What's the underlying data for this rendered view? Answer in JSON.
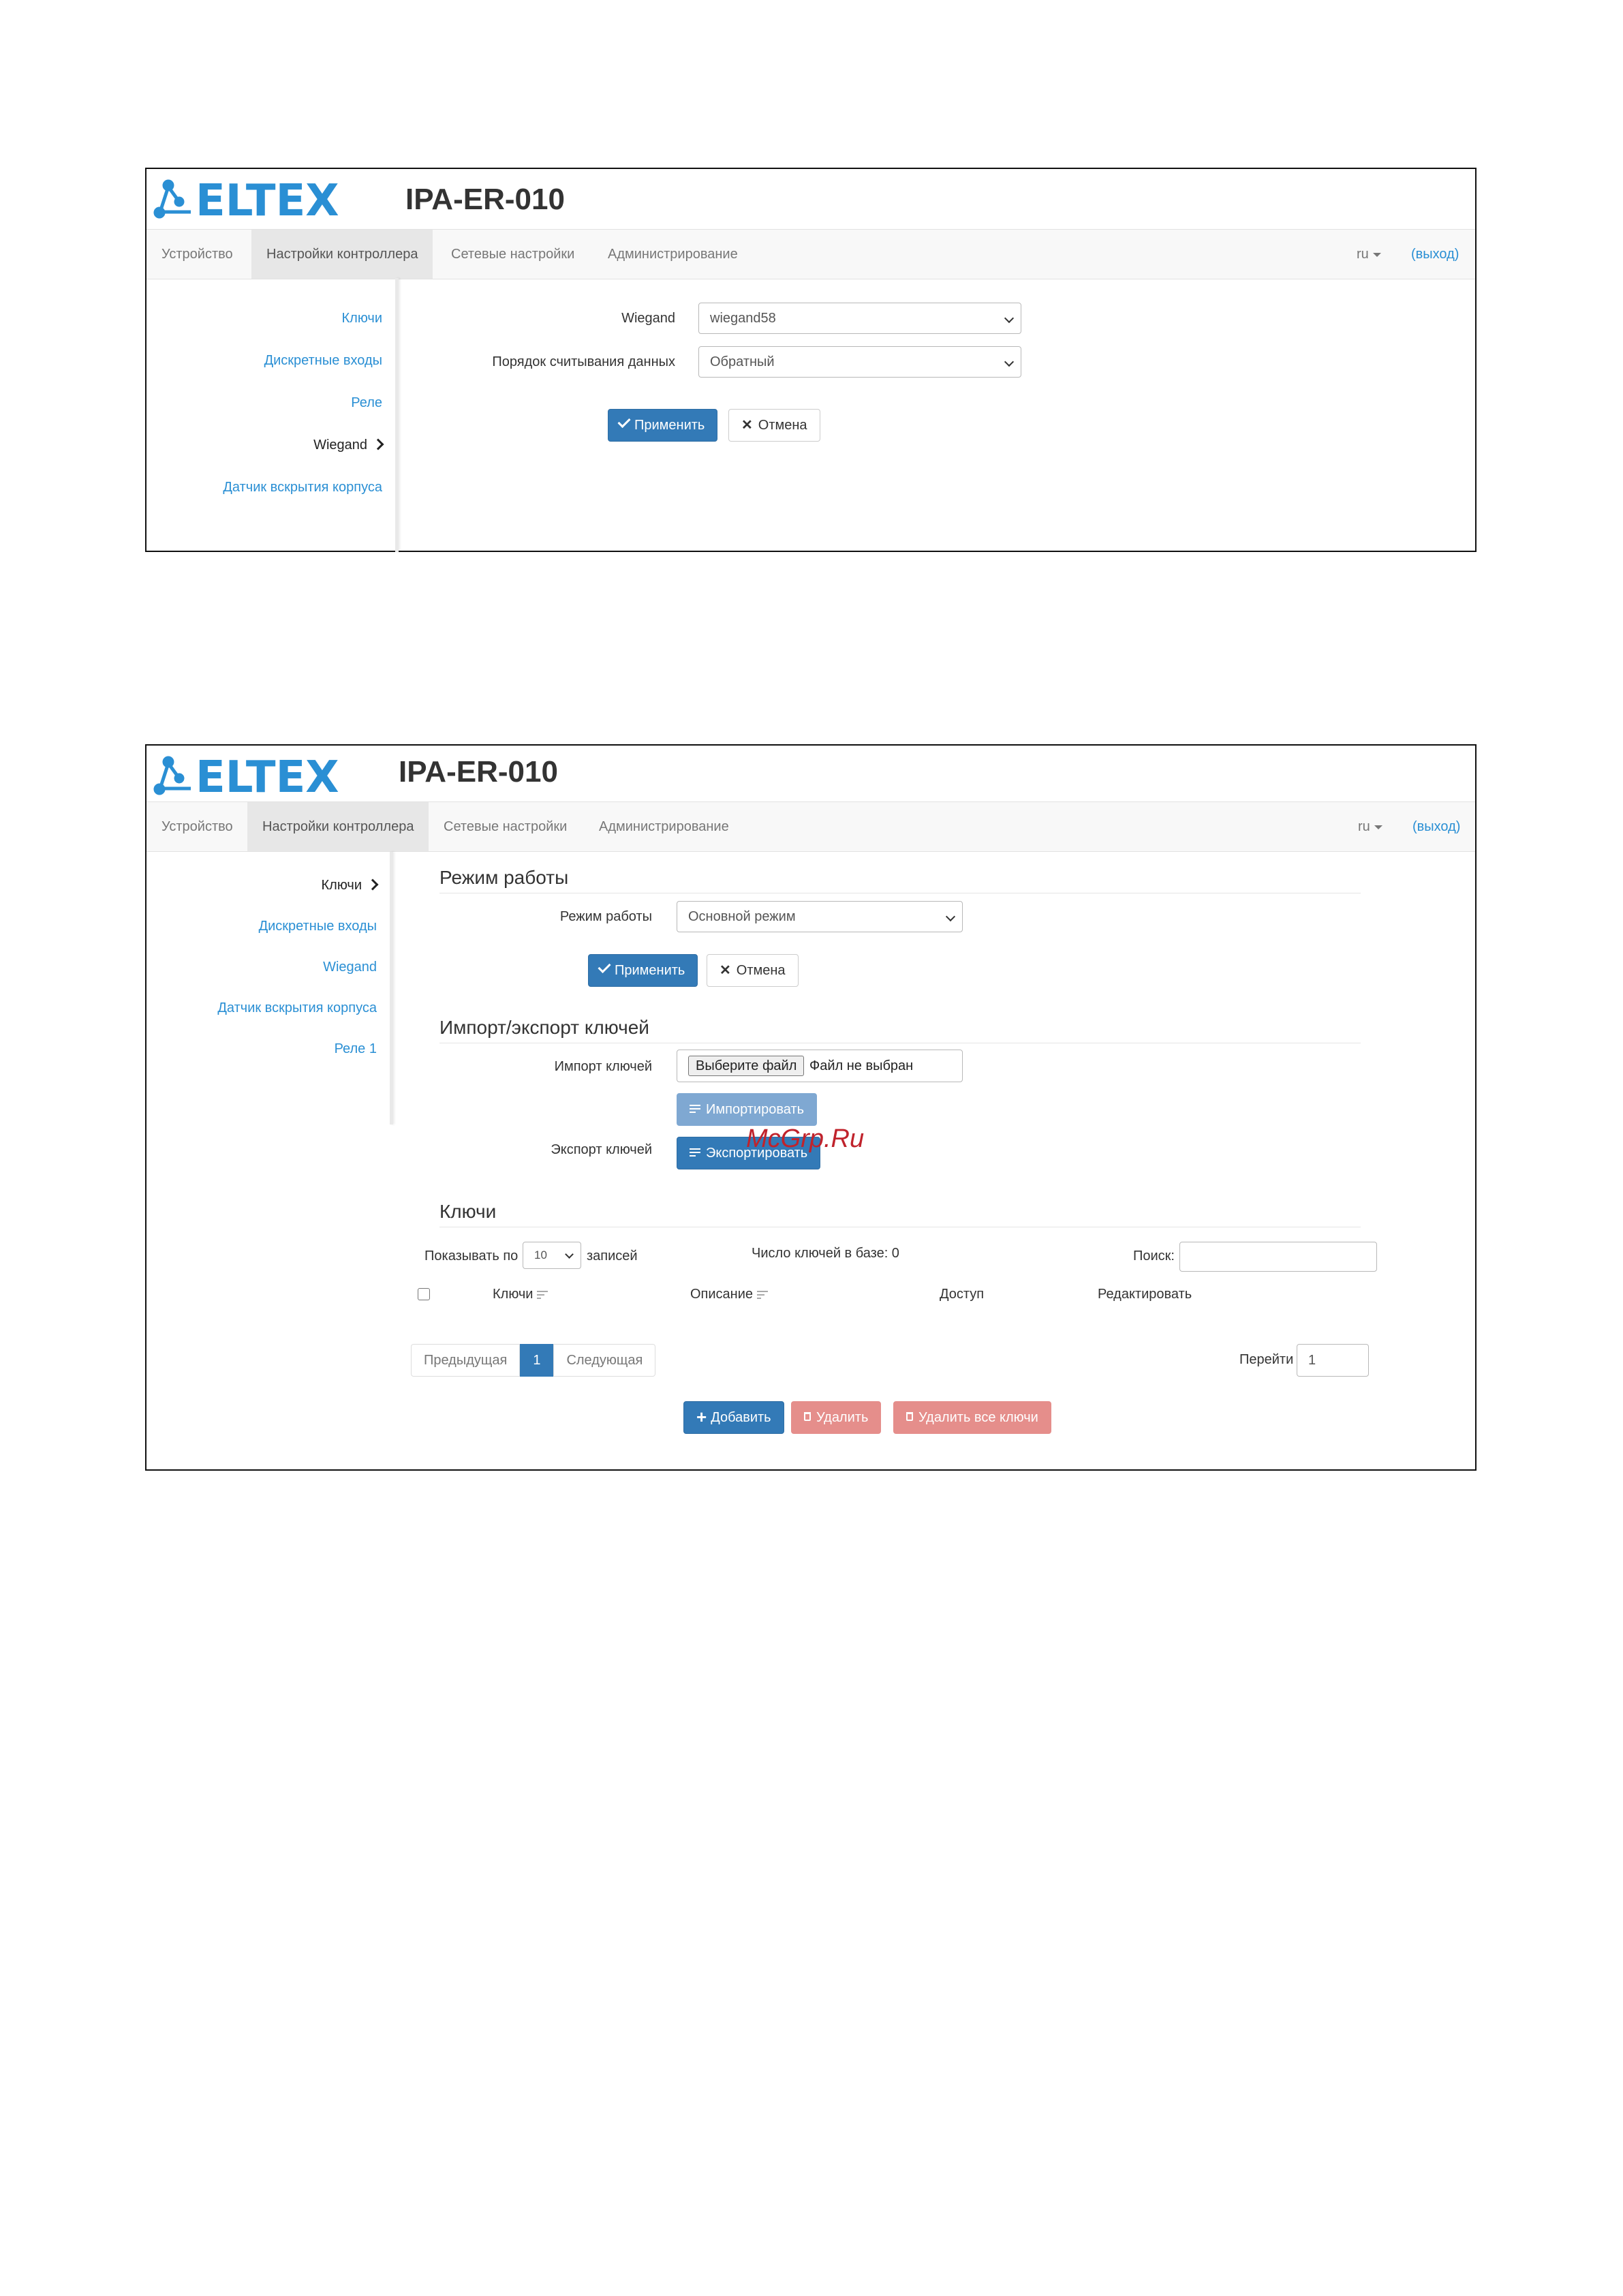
{
  "colors": {
    "brand": "#2a8fd4",
    "primary": "#337ab7",
    "danger_disabled": "#e58e8b",
    "watermark": "#c0232c"
  },
  "shot1": {
    "logo": "ELTEX",
    "title": "IPA-ER-010",
    "nav": [
      "Устройство",
      "Настройки контроллера",
      "Сетевые настройки",
      "Администрирование"
    ],
    "lang": "ru",
    "logout": "(выход)",
    "sidebar": [
      "Ключи",
      "Дискретные входы",
      "Реле",
      "Wiegand",
      "Датчик вскрытия корпуса"
    ],
    "form": {
      "wiegand_label": "Wiegand",
      "wiegand_value": "wiegand58",
      "order_label": "Порядок считывания данных",
      "order_value": "Обратный"
    },
    "apply": "Применить",
    "cancel": "Отмена"
  },
  "shot2": {
    "logo": "ELTEX",
    "title": "IPA-ER-010",
    "nav": [
      "Устройство",
      "Настройки контроллера",
      "Сетевые настройки",
      "Администрирование"
    ],
    "lang": "ru",
    "logout": "(выход)",
    "sidebar": [
      "Ключи",
      "Дискретные входы",
      "Wiegand",
      "Датчик вскрытия корпуса",
      "Реле 1"
    ],
    "mode_section": "Режим работы",
    "mode_label": "Режим работы",
    "mode_value": "Основной режим",
    "apply": "Применить",
    "cancel": "Отмена",
    "io_section": "Импорт/экспорт ключей",
    "import_label": "Импорт ключей",
    "file_button": "Выберите файл",
    "file_status": "Файл не выбран",
    "import_button": "Импортировать",
    "export_label": "Экспорт ключей",
    "export_button": "Экспортировать",
    "watermark": "McGrp.Ru",
    "keys_section": "Ключи",
    "show_prefix": "Показывать по",
    "page_size": "10",
    "show_suffix": "записей",
    "count_text": "Число ключей в базе: 0",
    "search_label": "Поиск:",
    "columns": [
      "Ключи",
      "Описание",
      "Доступ",
      "Редактировать"
    ],
    "pagination": {
      "prev": "Предыдущая",
      "page": "1",
      "next": "Следующая"
    },
    "goto_label": "Перейти",
    "goto_value": "1",
    "add_button": "Добавить",
    "delete_button": "Удалить",
    "delete_all_button": "Удалить все ключи"
  }
}
